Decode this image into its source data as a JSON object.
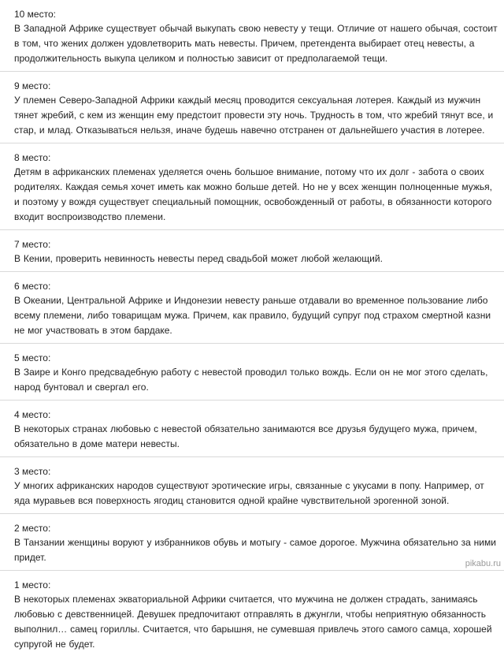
{
  "entries": [
    {
      "place": "10 место:",
      "text": "В Западной Африке существует обычай выкупать свою невесту у тещи. Отличие от нашего обычая, состоит в том, что жених должен удовлетворить мать невесты. Причем, претендента выбирает отец невесты, а продолжительность выкупа целиком и полностью зависит от предполагаемой тещи."
    },
    {
      "place": "9 место:",
      "text": "У племен Северо-Западной Африки каждый месяц проводится сексуальная лотерея. Каждый из мужчин тянет жребий, с кем из женщин ему предстоит провести эту ночь. Трудность в том, что жребий тянут все, и стар, и млад. Отказываться нельзя, иначе будешь навечно отстранен от дальнейшего участия в лотерее."
    },
    {
      "place": "8 место:",
      "text": "Детям в африканских племенах уделяется очень большое внимание, потому что их долг - забота о своих родителях. Каждая семья хочет иметь как можно больше детей. Но не у всех женщин полноценные мужья, и поэтому у вождя существует специальный помощник, освобожденный от работы, в обязанности которого входит воспроизводство племени."
    },
    {
      "place": "7 место:",
      "text": "В Кении, проверить невинность невесты перед свадьбой может любой желающий."
    },
    {
      "place": "6 место:",
      "text": "В Океании, Центральной Африке и Индонезии невесту раньше отдавали во временное пользование либо всему племени, либо товарищам мужа. Причем, как правило, будущий супруг под страхом смертной казни не мог участвовать в этом бардаке."
    },
    {
      "place": "5 место:",
      "text": "В Заире и Конго предсвадебную работу с невестой проводил только вождь. Если он не мог этого сделать, народ бунтовал и свергал его."
    },
    {
      "place": "4 место:",
      "text": "В некоторых странах любовью с невестой обязательно занимаются все друзья будущего мужа, причем, обязательно в доме матери невесты."
    },
    {
      "place": "3 место:",
      "text": "У многих африканских народов существуют эротические игры, связанные с укусами в попу. Например, от яда муравьев вся поверхность ягодиц становится одной крайне чувствительной эрогенной зоной."
    },
    {
      "place": "2 место:",
      "text": "В Танзании женщины воруют у избранников обувь и мотыгу - самое дорогое. Мужчина обязательно за ними придет."
    },
    {
      "place": "1 место:",
      "text": "В некоторых племенах экваториальной Африки считается, что мужчина не должен страдать, занимаясь любовью с девственницей. Девушек предпочитают отправлять в джунгли, чтобы неприятную обязанность выполнил… самец гориллы. Считается, что барышня, не сумевшая привлечь этого самого самца, хорошей супругой не будет."
    }
  ],
  "watermark": "pikabu.ru"
}
